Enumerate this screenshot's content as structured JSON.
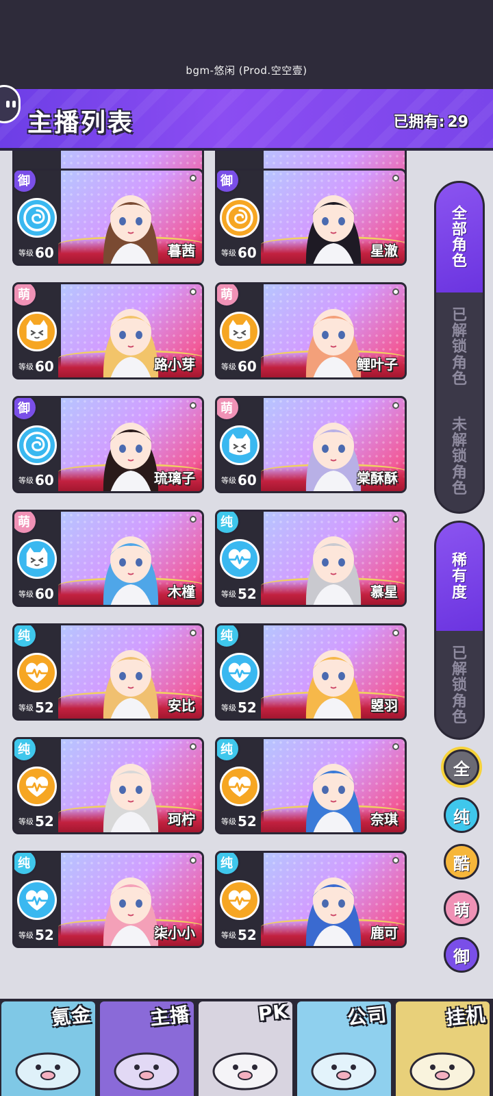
{
  "top": {
    "bgm_text": "bgm-悠闲 (Prod.空空壹)"
  },
  "header": {
    "title": "主播列表",
    "owned_label": "已拥有:",
    "owned_count": "29"
  },
  "list": {
    "level_label": "等级",
    "cards": [
      {
        "name": "暮茜",
        "attr": "御",
        "attr_color": "#7a4fe8",
        "type": "rose",
        "type_color": "#3ab8f0",
        "level": "60"
      },
      {
        "name": "星澈",
        "attr": "御",
        "attr_color": "#7a4fe8",
        "type": "rose",
        "type_color": "#f6a623",
        "level": "60"
      },
      {
        "name": "路小芽",
        "attr": "萌",
        "attr_color": "#f092b6",
        "type": "cat",
        "type_color": "#f6a623",
        "level": "60"
      },
      {
        "name": "鲤叶子",
        "attr": "萌",
        "attr_color": "#f092b6",
        "type": "cat",
        "type_color": "#f6a623",
        "level": "60"
      },
      {
        "name": "琉璃子",
        "attr": "御",
        "attr_color": "#7a4fe8",
        "type": "rose",
        "type_color": "#3ab8f0",
        "level": "60"
      },
      {
        "name": "棠酥酥",
        "attr": "萌",
        "attr_color": "#f092b6",
        "type": "cat",
        "type_color": "#3ab8f0",
        "level": "60"
      },
      {
        "name": "木槿",
        "attr": "萌",
        "attr_color": "#f092b6",
        "type": "cat",
        "type_color": "#3ab8f0",
        "level": "60"
      },
      {
        "name": "慕星",
        "attr": "纯",
        "attr_color": "#3fc7ec",
        "type": "heart",
        "type_color": "#3ab8f0",
        "level": "52"
      },
      {
        "name": "安比",
        "attr": "纯",
        "attr_color": "#3fc7ec",
        "type": "heart",
        "type_color": "#f6a623",
        "level": "52"
      },
      {
        "name": "曌羽",
        "attr": "纯",
        "attr_color": "#3fc7ec",
        "type": "heart",
        "type_color": "#3ab8f0",
        "level": "52"
      },
      {
        "name": "珂柠",
        "attr": "纯",
        "attr_color": "#3fc7ec",
        "type": "heart",
        "type_color": "#f6a623",
        "level": "52"
      },
      {
        "name": "奈琪",
        "attr": "纯",
        "attr_color": "#3fc7ec",
        "type": "heart",
        "type_color": "#f6a623",
        "level": "52"
      },
      {
        "name": "柒小小",
        "attr": "纯",
        "attr_color": "#3fc7ec",
        "type": "heart",
        "type_color": "#3ab8f0",
        "level": "52"
      },
      {
        "name": "鹿可",
        "attr": "纯",
        "attr_color": "#3fc7ec",
        "type": "heart",
        "type_color": "#f6a623",
        "level": "52"
      }
    ]
  },
  "filters": {
    "group1": [
      "全部角色",
      "已解锁角色",
      "未解锁角色"
    ],
    "group2": [
      "稀有度",
      "已解锁角色"
    ],
    "rarity": [
      {
        "label": "全",
        "color": "#6b6a74"
      },
      {
        "label": "纯",
        "color": "#3fc7ec"
      },
      {
        "label": "酷",
        "color": "#f6b63a"
      },
      {
        "label": "萌",
        "color": "#f092b6"
      },
      {
        "label": "御",
        "color": "#7a4fe8"
      }
    ]
  },
  "bottom_nav": [
    {
      "label": "氪金",
      "bg": "#7fc8e6"
    },
    {
      "label": "主播",
      "bg": "#8a6ad8"
    },
    {
      "label": "PK",
      "bg": "#d8d4e0"
    },
    {
      "label": "公司",
      "bg": "#8fd0ee"
    },
    {
      "label": "挂机",
      "bg": "#e8d07a"
    }
  ]
}
